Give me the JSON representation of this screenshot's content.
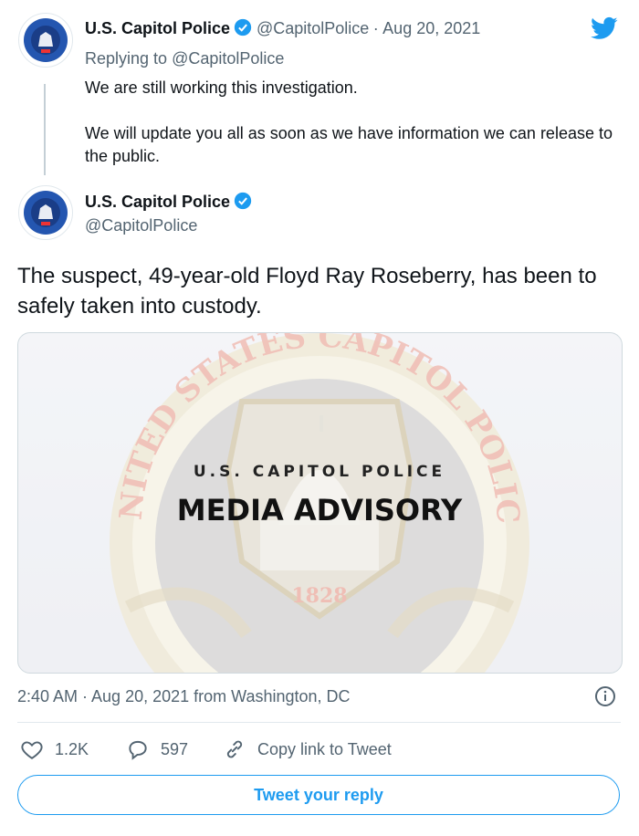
{
  "tweet_parent": {
    "name": "U.S. Capitol Police",
    "handle": "@CapitolPolice",
    "separator": "·",
    "date": "Aug 20, 2021",
    "replying_prefix": "Replying to",
    "replying_to": "@CapitolPolice",
    "line1": "We are still working this investigation.",
    "line2": "We will update you all as soon as we have information we can release to the public."
  },
  "tweet_main": {
    "name": "U.S. Capitol Police",
    "handle": "@CapitolPolice",
    "text": "The suspect, 49-year-old Floyd Ray Roseberry, has been to safely taken into custody.",
    "media": {
      "seal_top_text": "UNITED STATES CAPITOL POLICE",
      "seal_year": "1828",
      "header": "U.S. CAPITOL POLICE",
      "title": "MEDIA ADVISORY"
    },
    "timestamp": "2:40 AM · Aug 20, 2021 from Washington, DC",
    "likes": "1.2K",
    "replies": "597",
    "copy_link": "Copy link to Tweet",
    "reply_button": "Tweet your reply"
  },
  "colors": {
    "brand": "#1d9bf0",
    "text": "#0f1419",
    "muted": "#536471"
  },
  "icons": [
    "twitter-bird-icon",
    "verified-badge-icon",
    "info-icon",
    "heart-icon",
    "reply-bubble-icon",
    "link-icon"
  ]
}
